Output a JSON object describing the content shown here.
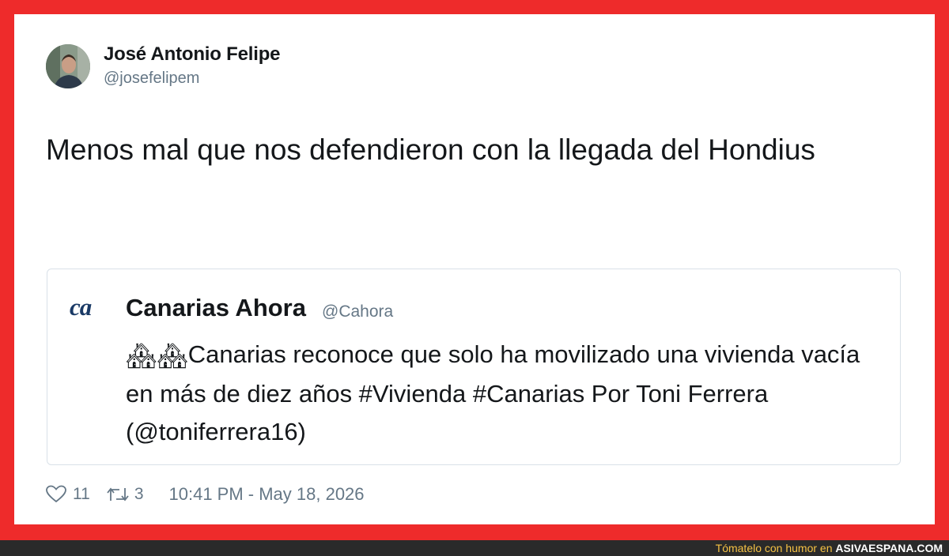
{
  "tweet": {
    "author_name": "José Antonio Felipe",
    "author_handle": "@josefelipem",
    "text": "Menos mal que nos defendieron con la llegada del Hondius",
    "likes": "11",
    "retweets": "3",
    "timestamp": "10:41 PM - May 18, 2026"
  },
  "quoted": {
    "logo_text": "ca",
    "name": "Canarias Ahora",
    "handle": "@Cahora",
    "emoji": "🏘🏘",
    "text": "Canarias reconoce que solo ha movilizado una vivienda vacía en más de diez años #Vivienda #Canarias Por Toni Ferrera (@toniferrera16)"
  },
  "watermark": {
    "lead": "Tómatelo con humor en",
    "site": "ASIVAESPANA.COM"
  },
  "icons": {
    "like": "heart-icon",
    "retweet": "retweet-icon"
  },
  "colors": {
    "frame": "#ee2b2b",
    "logo": "#1a3a66",
    "secondary_text": "#657786"
  }
}
